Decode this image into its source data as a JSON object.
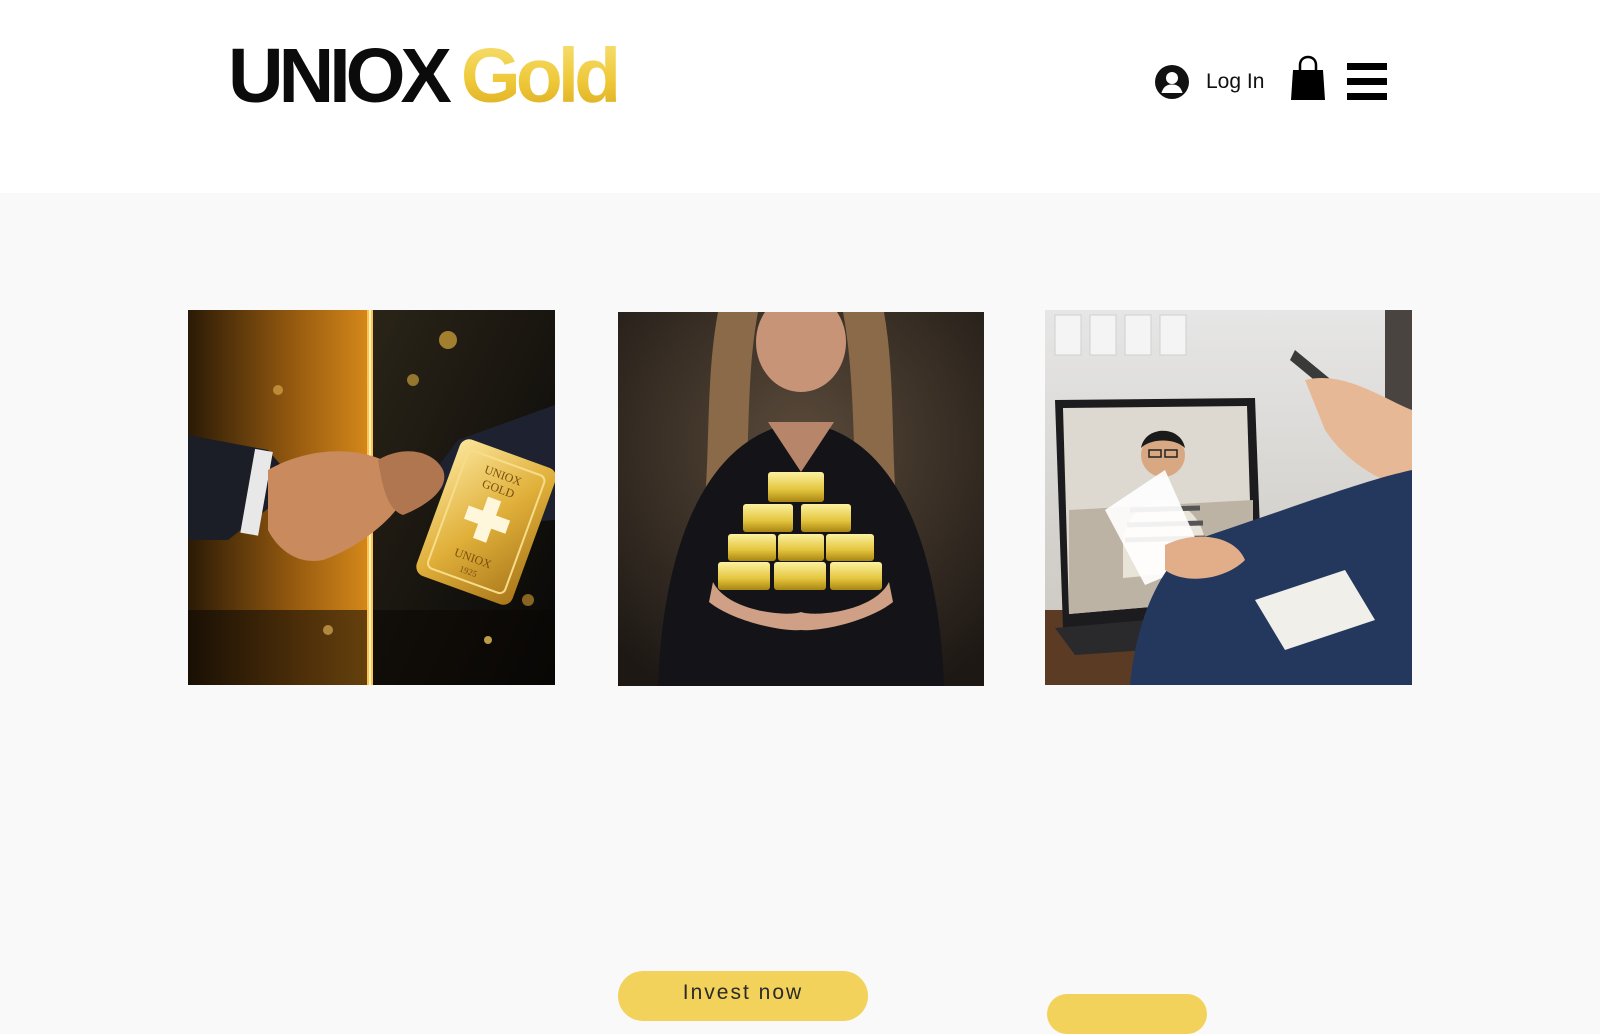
{
  "header": {
    "logo": {
      "dark_text": "UNIOX",
      "gold_text": "Gold"
    },
    "login": {
      "icon": "user-avatar-icon",
      "label": "Log In"
    },
    "cart_icon": "shopping-bag-icon",
    "menu_icon": "hamburger-menu-icon"
  },
  "gallery": {
    "images": [
      {
        "name": "handshake-gold-bar-image",
        "bar_text": [
          "UNIOX",
          "GOLD",
          "UNIOX",
          "1925"
        ]
      },
      {
        "name": "woman-holding-gold-bars-image"
      },
      {
        "name": "video-call-laptop-image"
      }
    ]
  },
  "cta": {
    "invest_label": "Invest now"
  },
  "colors": {
    "accent_gold": "#f2d25a",
    "logo_gold": "#efc93a",
    "page_bg": "#f9f9f9",
    "header_bg": "#ffffff"
  }
}
